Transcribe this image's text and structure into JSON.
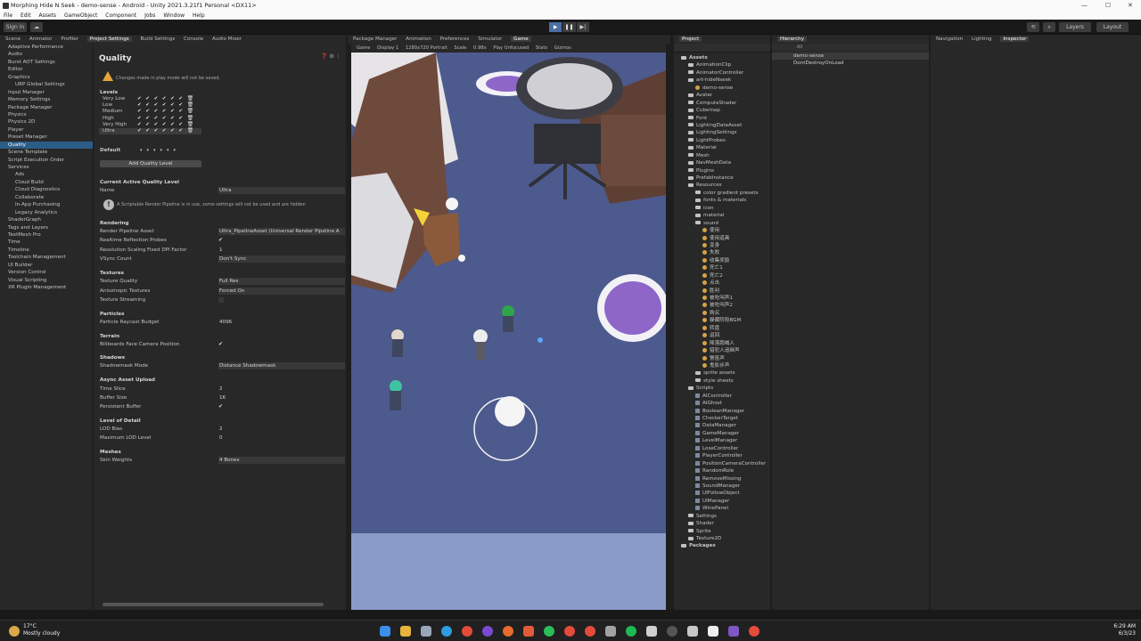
{
  "window": {
    "title": "Morphing Hide N Seek - demo-sense - Android - Unity 2021.3.21f1 Personal <DX11>",
    "controls": [
      "—",
      "☐",
      "✕"
    ]
  },
  "menu": [
    "File",
    "Edit",
    "Assets",
    "GameObject",
    "Component",
    "Jobs",
    "Window",
    "Help"
  ],
  "toolbar": {
    "sign_in": "Sign in",
    "layers": "Layers",
    "layout": "Layout"
  },
  "tabs_left": [
    "Scene",
    "Animator",
    "Profiler",
    "Project Settings",
    "Build Settings",
    "Console",
    "Audio Mixer"
  ],
  "tabs_mid": [
    "Package Manager",
    "Animation",
    "Preferences",
    "Simulator",
    "Game"
  ],
  "tabs_project": [
    "Project"
  ],
  "tabs_hier": [
    "Hierarchy"
  ],
  "tabs_right": [
    "Navigation",
    "Lighting",
    "Inspector"
  ],
  "settings_list": [
    {
      "label": "Adaptive Performance",
      "sub": false
    },
    {
      "label": "Audio",
      "sub": false
    },
    {
      "label": "Burst AOT Settings",
      "sub": false
    },
    {
      "label": "Editor",
      "sub": false
    },
    {
      "label": "Graphics",
      "sub": false
    },
    {
      "label": "URP Global Settings",
      "sub": true
    },
    {
      "label": "Input Manager",
      "sub": false
    },
    {
      "label": "Memory Settings",
      "sub": false
    },
    {
      "label": "Package Manager",
      "sub": false
    },
    {
      "label": "Physics",
      "sub": false
    },
    {
      "label": "Physics 2D",
      "sub": false
    },
    {
      "label": "Player",
      "sub": false
    },
    {
      "label": "Preset Manager",
      "sub": false
    },
    {
      "label": "Quality",
      "sub": false,
      "selected": true
    },
    {
      "label": "Scene Template",
      "sub": false
    },
    {
      "label": "Script Execution Order",
      "sub": false
    },
    {
      "label": "Services",
      "sub": false
    },
    {
      "label": "Ads",
      "sub": true
    },
    {
      "label": "Cloud Build",
      "sub": true
    },
    {
      "label": "Cloud Diagnostics",
      "sub": true
    },
    {
      "label": "Collaborate",
      "sub": true
    },
    {
      "label": "In-App Purchasing",
      "sub": true
    },
    {
      "label": "Legacy Analytics",
      "sub": true
    },
    {
      "label": "ShaderGraph",
      "sub": false
    },
    {
      "label": "Tags and Layers",
      "sub": false
    },
    {
      "label": "TextMesh Pro",
      "sub": false
    },
    {
      "label": "Time",
      "sub": false
    },
    {
      "label": "Timeline",
      "sub": false
    },
    {
      "label": "Toolchain Management",
      "sub": false
    },
    {
      "label": "UI Builder",
      "sub": false
    },
    {
      "label": "Version Control",
      "sub": false
    },
    {
      "label": "Visual Scripting",
      "sub": false
    },
    {
      "label": "XR Plugin Management",
      "sub": false
    }
  ],
  "quality": {
    "title": "Quality",
    "play_warning": "Changes made in play mode will not be saved.",
    "levels_label": "Levels",
    "levels": [
      "Very Low",
      "Low",
      "Medium",
      "High",
      "Very High",
      "Ultra"
    ],
    "default_label": "Default",
    "add_level": "Add Quality Level",
    "current_header": "Current Active Quality Level",
    "name_label": "Name",
    "name_value": "Ultra",
    "srp_info": "A Scriptable Render Pipeline is in use, some settings will not be used and are hidden",
    "rendering_header": "Rendering",
    "render_pipeline_label": "Render Pipeline Asset",
    "render_pipeline_value": "Ultra_PipelineAsset (Universal Render Pipeline A",
    "realtime_reflection_label": "Realtime Reflection Probes",
    "res_scaling_label": "Resolution Scaling Fixed DPI Factor",
    "res_scaling_value": "1",
    "vsync_label": "VSync Count",
    "vsync_value": "Don't Sync",
    "textures_header": "Textures",
    "texture_quality_label": "Texture Quality",
    "texture_quality_value": "Full Res",
    "aniso_label": "Anisotropic Textures",
    "aniso_value": "Forced On",
    "tex_streaming_label": "Texture Streaming",
    "particles_header": "Particles",
    "raycast_label": "Particle Raycast Budget",
    "raycast_value": "4096",
    "terrain_header": "Terrain",
    "billboards_label": "Billboards Face Camera Position",
    "shadows_header": "Shadows",
    "shadowmask_label": "Shadowmask Mode",
    "shadowmask_value": "Distance Shadowmask",
    "async_header": "Async Asset Upload",
    "time_slice_label": "Time Slice",
    "time_slice_value": "2",
    "buffer_size_label": "Buffer Size",
    "buffer_size_value": "16",
    "persistent_label": "Persistent Buffer",
    "lod_header": "Level of Detail",
    "lod_bias_label": "LOD Bias",
    "lod_bias_value": "2",
    "max_lod_label": "Maximum LOD Level",
    "max_lod_value": "0",
    "meshes_header": "Meshes",
    "skin_label": "Skin Weights",
    "skin_value": "4 Bones"
  },
  "gamebar": [
    "Game",
    "Display 1",
    "1280x720 Portrait",
    "Scale",
    "0.98x",
    "Play Unfocused",
    "Stats",
    "Gizmos"
  ],
  "project_tree": [
    {
      "label": "Assets",
      "depth": 0,
      "kind": "folder",
      "bold": true
    },
    {
      "label": "AnimationClip",
      "depth": 1,
      "kind": "folder"
    },
    {
      "label": "AnimatorController",
      "depth": 1,
      "kind": "folder"
    },
    {
      "label": "art-hideNseek",
      "depth": 1,
      "kind": "folder"
    },
    {
      "label": "demo-sense",
      "depth": 2,
      "kind": "unity"
    },
    {
      "label": "Avatar",
      "depth": 1,
      "kind": "folder"
    },
    {
      "label": "ComputeShader",
      "depth": 1,
      "kind": "folder"
    },
    {
      "label": "Cubemap",
      "depth": 1,
      "kind": "folder"
    },
    {
      "label": "Font",
      "depth": 1,
      "kind": "folder"
    },
    {
      "label": "LightingDataAsset",
      "depth": 1,
      "kind": "folder"
    },
    {
      "label": "LightingSettings",
      "depth": 1,
      "kind": "folder"
    },
    {
      "label": "LightProbes",
      "depth": 1,
      "kind": "folder"
    },
    {
      "label": "Material",
      "depth": 1,
      "kind": "folder"
    },
    {
      "label": "Mesh",
      "depth": 1,
      "kind": "folder"
    },
    {
      "label": "NavMeshData",
      "depth": 1,
      "kind": "folder"
    },
    {
      "label": "Plugins",
      "depth": 1,
      "kind": "folder"
    },
    {
      "label": "PrefabInstance",
      "depth": 1,
      "kind": "folder"
    },
    {
      "label": "Resources",
      "depth": 1,
      "kind": "folder"
    },
    {
      "label": "color gradient presets",
      "depth": 2,
      "kind": "folder"
    },
    {
      "label": "fonts & materials",
      "depth": 2,
      "kind": "folder"
    },
    {
      "label": "icon",
      "depth": 2,
      "kind": "folder"
    },
    {
      "label": "material",
      "depth": 2,
      "kind": "folder"
    },
    {
      "label": "sound",
      "depth": 2,
      "kind": "folder"
    },
    {
      "label": "使用",
      "depth": 3,
      "kind": "sound"
    },
    {
      "label": "使用道具",
      "depth": 3,
      "kind": "sound"
    },
    {
      "label": "变身",
      "depth": 3,
      "kind": "sound"
    },
    {
      "label": "失败",
      "depth": 3,
      "kind": "sound"
    },
    {
      "label": "收集奖励",
      "depth": 3,
      "kind": "sound"
    },
    {
      "label": "死亡1",
      "depth": 3,
      "kind": "sound"
    },
    {
      "label": "死亡2",
      "depth": 3,
      "kind": "sound"
    },
    {
      "label": "点击",
      "depth": 3,
      "kind": "sound"
    },
    {
      "label": "胜利",
      "depth": 3,
      "kind": "sound"
    },
    {
      "label": "被吃叫声1",
      "depth": 3,
      "kind": "sound"
    },
    {
      "label": "被吃叫声2",
      "depth": 3,
      "kind": "sound"
    },
    {
      "label": "购买",
      "depth": 3,
      "kind": "sound"
    },
    {
      "label": "躲藏阶段BGM",
      "depth": 3,
      "kind": "sound"
    },
    {
      "label": "转盘",
      "depth": 3,
      "kind": "sound"
    },
    {
      "label": "返回",
      "depth": 3,
      "kind": "sound"
    },
    {
      "label": "降落跑喊人",
      "depth": 3,
      "kind": "sound"
    },
    {
      "label": "猎犯人追继声",
      "depth": 3,
      "kind": "sound"
    },
    {
      "label": "警笛声",
      "depth": 3,
      "kind": "sound"
    },
    {
      "label": "鬼影步声",
      "depth": 3,
      "kind": "sound"
    },
    {
      "label": "sprite assets",
      "depth": 2,
      "kind": "folder"
    },
    {
      "label": "style sheets",
      "depth": 2,
      "kind": "folder"
    },
    {
      "label": "Scripts",
      "depth": 1,
      "kind": "folder"
    },
    {
      "label": "AIController",
      "depth": 2,
      "kind": "cs"
    },
    {
      "label": "AIGhost",
      "depth": 2,
      "kind": "cs"
    },
    {
      "label": "BooleanManager",
      "depth": 2,
      "kind": "cs"
    },
    {
      "label": "CheckerTarget",
      "depth": 2,
      "kind": "cs"
    },
    {
      "label": "DataManager",
      "depth": 2,
      "kind": "cs"
    },
    {
      "label": "GameManager",
      "depth": 2,
      "kind": "cs"
    },
    {
      "label": "LevelManager",
      "depth": 2,
      "kind": "cs"
    },
    {
      "label": "LoseController",
      "depth": 2,
      "kind": "cs"
    },
    {
      "label": "PlayerController",
      "depth": 2,
      "kind": "cs"
    },
    {
      "label": "PositionCameraController",
      "depth": 2,
      "kind": "cs"
    },
    {
      "label": "RandomRole",
      "depth": 2,
      "kind": "cs"
    },
    {
      "label": "RemoveMissing",
      "depth": 2,
      "kind": "cs"
    },
    {
      "label": "SoundManager",
      "depth": 2,
      "kind": "cs"
    },
    {
      "label": "UIFollowObject",
      "depth": 2,
      "kind": "cs"
    },
    {
      "label": "UIManager",
      "depth": 2,
      "kind": "cs"
    },
    {
      "label": "WinePanel",
      "depth": 2,
      "kind": "cs"
    },
    {
      "label": "Settings",
      "depth": 1,
      "kind": "folder"
    },
    {
      "label": "Shader",
      "depth": 1,
      "kind": "folder"
    },
    {
      "label": "Sprite",
      "depth": 1,
      "kind": "folder"
    },
    {
      "label": "Texture2D",
      "depth": 1,
      "kind": "folder"
    },
    {
      "label": "Packages",
      "depth": 0,
      "kind": "folder",
      "bold": true
    }
  ],
  "hierarchy": [
    "demo-sense",
    "DontDestroyOnLoad"
  ],
  "hier_search_placeholder": "All",
  "taskbar": {
    "temp": "17°C",
    "weather": "Mostly cloudy",
    "time": "6:29 AM",
    "date": "6/3/23"
  }
}
